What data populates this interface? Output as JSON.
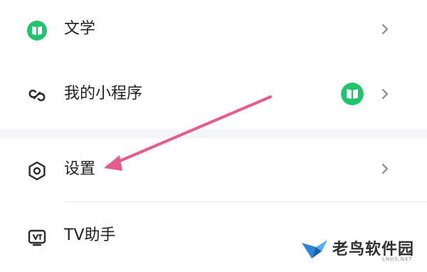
{
  "menu": {
    "literature": {
      "label": "文学",
      "icon": "book-icon"
    },
    "mini_programs": {
      "label": "我的小程序",
      "icon": "link-icon",
      "badge_icon": "book-icon"
    },
    "settings": {
      "label": "设置",
      "icon": "hexagon-settings-icon"
    },
    "tv_assistant": {
      "label": "TV助手",
      "icon": "tv-icon"
    }
  },
  "colors": {
    "brand_green": "#1fc46c",
    "arrow_pink": "#e75a8e",
    "section_gap": "#f4f5f8"
  },
  "watermark": {
    "name": "老鸟软件园",
    "url": "LNUS.NET"
  }
}
